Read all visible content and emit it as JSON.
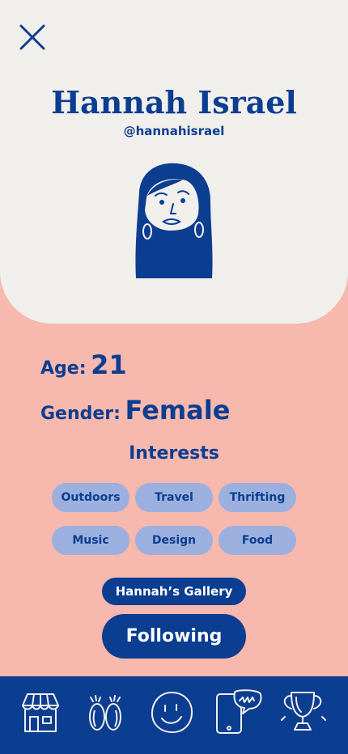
{
  "colors": {
    "primary": "#0B3D91",
    "hero_bg": "#F1EFEC",
    "page_bg": "#F7B8AE",
    "chip_bg": "#9BB0DE"
  },
  "profile": {
    "name": "Hannah Israel",
    "handle": "@hannahisrael",
    "age_label": "Age:",
    "age_value": "21",
    "gender_label": "Gender:",
    "gender_value": "Female"
  },
  "interests": {
    "title": "Interests",
    "items": [
      "Outdoors",
      "Travel",
      "Thrifting",
      "Music",
      "Design",
      "Food"
    ]
  },
  "actions": {
    "gallery_label": "Hannah’s Gallery",
    "follow_label": "Following"
  },
  "nav": {
    "items": [
      "shop-icon",
      "footprints-icon",
      "smiley-icon",
      "phone-chat-icon",
      "trophy-icon"
    ]
  }
}
